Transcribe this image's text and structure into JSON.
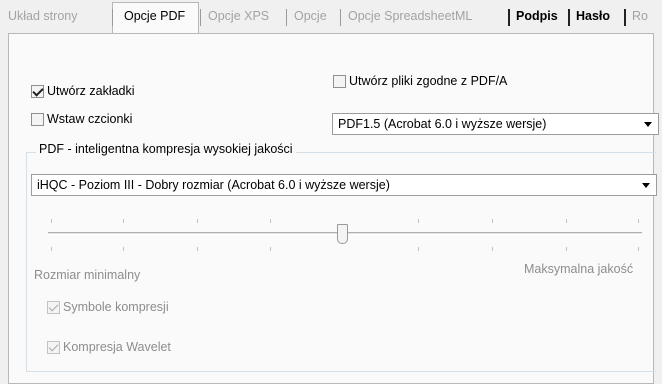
{
  "tabs": [
    {
      "label": "Układ strony",
      "state": "disabled"
    },
    {
      "label": "Opcje PDF",
      "state": "active"
    },
    {
      "label": "Opcje XPS",
      "state": "disabled"
    },
    {
      "label": "Opcje",
      "state": "disabled"
    },
    {
      "label": "Opcje SpreadsheetML",
      "state": "disabled"
    },
    {
      "label": "Podpis",
      "state": "bold"
    },
    {
      "label": "Hasło",
      "state": "bold"
    },
    {
      "label": "Ro",
      "state": "disabled"
    }
  ],
  "options": {
    "create_bookmarks": {
      "label": "Utwórz zakładki",
      "checked": true
    },
    "embed_fonts": {
      "label": "Wstaw czcionki",
      "checked": false
    },
    "pdfa": {
      "label": "Utwórz pliki zgodne z PDF/A",
      "checked": false
    },
    "pdf_version": "PDF1.5 (Acrobat 6.0 i wyższe wersje)"
  },
  "compression": {
    "group_title": "PDF - inteligentna kompresja wysokiej jakości",
    "level": "iHQC - Poziom III - Dobry rozmiar (Acrobat 6.0 i wyższe wersje)",
    "slider_level_fraction": 0.5,
    "min_label": "Rozmiar minimalny",
    "max_label": "Maksymalna jakość",
    "symbols": {
      "label": "Symbole kompresji",
      "checked": true,
      "enabled": false
    },
    "wavelet": {
      "label": "Kompresja Wavelet",
      "checked": true,
      "enabled": false
    }
  }
}
